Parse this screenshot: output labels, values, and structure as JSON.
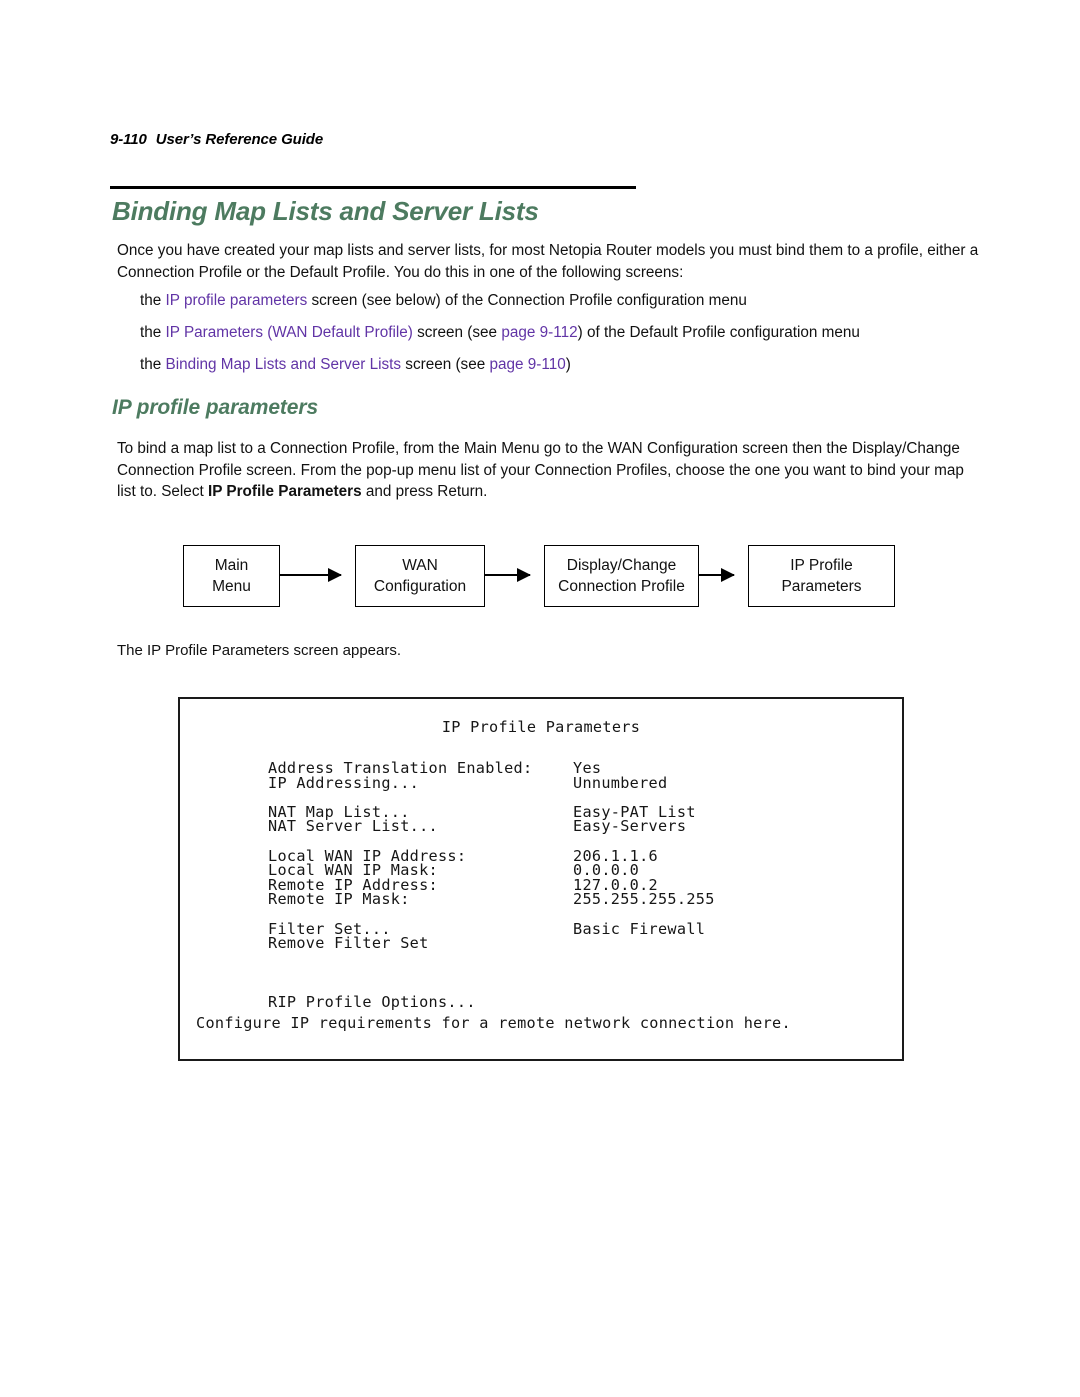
{
  "running_header": {
    "folio": "9-110",
    "title": "User’s Reference Guide"
  },
  "headings": {
    "chapter": "Binding Map Lists and Server Lists",
    "section": "IP profile parameters",
    "color": "#4d7b60"
  },
  "link_color": "#6134a6",
  "intro_paragraph": "Once you have created your map lists and server lists, for most Netopia Router models you must bind them to a profile, either a Connection Profile or the Default Profile. You do this in one of the following screens:",
  "bullets": [
    {
      "pre": "the ",
      "link": "IP profile parameters",
      "post": " screen (see below) of the Connection Profile configuration menu"
    },
    {
      "pre": "the ",
      "link": "IP Parameters (WAN Default Profile)",
      "mid": " screen (see ",
      "link2": "page 9-112",
      "post": ") of the Default Profile configuration menu"
    },
    {
      "pre": "the ",
      "link": "Binding Map Lists and Server Lists",
      "mid": " screen (see ",
      "link2": "page 9-110",
      "post": ")"
    }
  ],
  "bind_paragraph": {
    "part1": "To bind a map list to a Connection Profile, from the Main Menu go to the WAN Configuration screen then the Display/Change Connection Profile screen. From the pop-up menu list of your Connection Profiles, choose the one you want to bind your map list to. Select ",
    "bold": "IP Profile Parameters",
    "part2": " and press Return."
  },
  "flow_diagram": {
    "boxes": [
      {
        "line1": "Main",
        "line2": "Menu"
      },
      {
        "line1": "WAN",
        "line2": "Configuration"
      },
      {
        "line1": "Display/Change",
        "line2": "Connection Profile"
      },
      {
        "line1": "IP Profile",
        "line2": "Parameters"
      }
    ]
  },
  "caption": "The IP Profile Parameters screen appears.",
  "terminal": {
    "title": "IP Profile Parameters",
    "rows": [
      {
        "label": "Address Translation Enabled:",
        "value": "Yes"
      },
      {
        "label": "IP Addressing...",
        "value": "Unnumbered"
      },
      {
        "gap": true
      },
      {
        "label": "NAT Map List...",
        "value": "Easy-PAT List"
      },
      {
        "label": "NAT Server List...",
        "value": "Easy-Servers"
      },
      {
        "gap": true
      },
      {
        "label": "Local WAN IP Address:",
        "value": "206.1.1.6"
      },
      {
        "label": "Local WAN IP Mask:",
        "value": "0.0.0.0"
      },
      {
        "label": "Remote IP Address:",
        "value": "127.0.0.2"
      },
      {
        "label": "Remote IP Mask:",
        "value": "255.255.255.255"
      },
      {
        "gap": true
      },
      {
        "label": "Filter Set...",
        "value": "Basic Firewall"
      },
      {
        "label": "Remove Filter Set",
        "value": ""
      },
      {
        "gap_lg": true
      },
      {
        "label": "RIP Profile Options...",
        "value": ""
      }
    ],
    "footer": "Configure IP requirements for a remote network connection here."
  }
}
